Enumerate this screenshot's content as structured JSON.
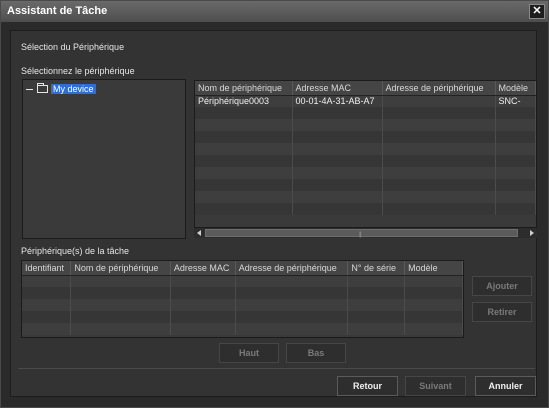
{
  "window": {
    "title": "Assistant de Tâche",
    "close_glyph": "✕"
  },
  "section_title": "Sélection du Périphérique",
  "select_label": "Sélectionnez le périphérique",
  "tree": {
    "root_label": "My device",
    "expanded": true
  },
  "device_grid": {
    "columns": [
      "Nom de périphérique",
      "Adresse MAC",
      "Adresse de périphérique",
      "Modèle"
    ],
    "rows": [
      [
        "Périphérique0003",
        "00-01-4A-31-AB-A7",
        "",
        "SNC-"
      ]
    ],
    "empty_rows": 9
  },
  "task_label": "Périphérique(s) de la tâche",
  "task_grid": {
    "columns": [
      "Identifiant",
      "Nom de périphérique",
      "Adresse MAC",
      "Adresse de périphérique",
      "N° de série",
      "Modèle"
    ],
    "rows": [],
    "empty_rows": 5
  },
  "buttons": {
    "add": "Ajouter",
    "remove": "Retirer",
    "up": "Haut",
    "down": "Bas",
    "back": "Retour",
    "next": "Suivant",
    "cancel": "Annuler"
  },
  "colors": {
    "selection": "#2f6fd4",
    "background": "#2a2a2a"
  }
}
